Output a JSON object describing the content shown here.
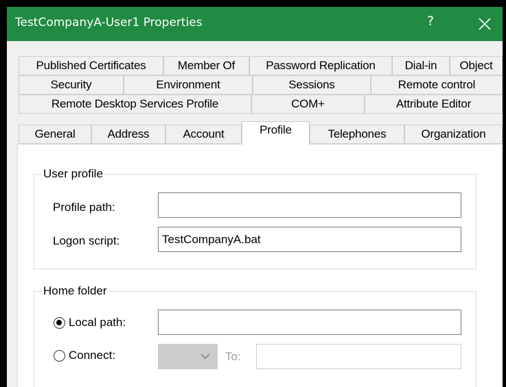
{
  "window": {
    "title": "TestCompanyA-User1 Properties",
    "help_label": "?",
    "titlebar_color": "#218a43"
  },
  "tabs": {
    "row1": [
      "Published Certificates",
      "Member Of",
      "Password Replication",
      "Dial-in",
      "Object"
    ],
    "row2": [
      "Security",
      "Environment",
      "Sessions",
      "Remote control"
    ],
    "row3": [
      "Remote Desktop Services Profile",
      "COM+",
      "Attribute Editor"
    ],
    "row4": [
      "General",
      "Address",
      "Account",
      "Profile",
      "Telephones",
      "Organization"
    ],
    "active": "Profile"
  },
  "user_profile": {
    "legend": "User profile",
    "profile_path_label": "Profile path:",
    "profile_path_value": "",
    "logon_script_label": "Logon script:",
    "logon_script_value": "TestCompanyA.bat"
  },
  "home_folder": {
    "legend": "Home folder",
    "local_path_label": "Local path:",
    "local_path_selected": true,
    "local_path_value": "",
    "connect_label": "Connect:",
    "connect_drive_value": "",
    "to_label": "To:",
    "to_value": ""
  }
}
